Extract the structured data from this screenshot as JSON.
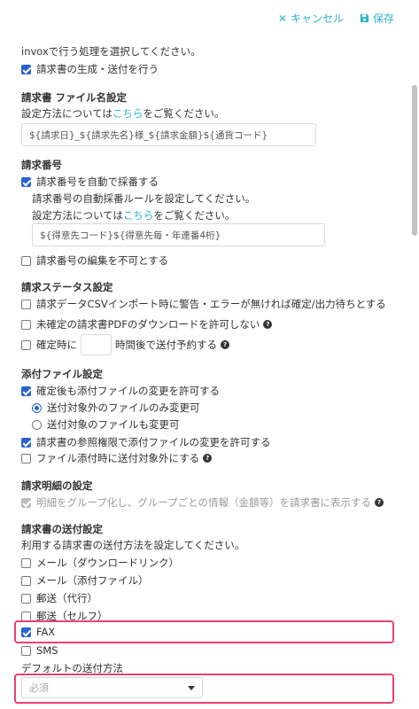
{
  "topbar": {
    "cancel_label": "キャンセル",
    "save_label": "保存"
  },
  "processing": {
    "intro": "invoxで行う処理を選択してください。",
    "generate_send": "請求書の生成・送付を行う"
  },
  "filename": {
    "heading": "請求書 ファイル名設定",
    "method_prefix": "設定方法については",
    "link": "こちら",
    "method_suffix": "をご覧ください。",
    "value": "${請求日}_${請求先名}様_${請求金額}${通貨コード}"
  },
  "invoice_number": {
    "heading": "請求番号",
    "auto_number": "請求番号を自動で採番する",
    "rule_text": "請求番号の自動採番ルールを設定してください。",
    "method_prefix": "設定方法については",
    "link": "こちら",
    "method_suffix": "をご覧ください。",
    "value": "${得意先コード}${得意先毎・年連番4桁}",
    "disable_edit": "請求番号の編集を不可とする"
  },
  "status": {
    "heading": "請求ステータス設定",
    "csv_option": "請求データCSVインポート時に警告・エラーが無ければ確定/出力待ちとする",
    "pdf_option": "未確定の請求書PDFのダウンロードを許可しない",
    "schedule_prefix": "確定時に",
    "schedule_suffix": "時間後で送付予約する"
  },
  "attachments": {
    "heading": "添付ファイル設定",
    "allow_change": "確定後も添付ファイルの変更を許可する",
    "radio_exclude_only": "送付対象外のファイルのみ変更可",
    "radio_include": "送付対象のファイルも変更可",
    "perm_option": "請求書の参照権限で添付ファイルの変更を許可する",
    "exclude_on_attach": "ファイル添付時に送付対象外にする"
  },
  "details": {
    "heading": "請求明細の設定",
    "group_option": "明細をグループ化し、グループごとの情報（金額等）を請求書に表示する"
  },
  "sending": {
    "heading": "請求書の送付設定",
    "intro": "利用する請求書の送付方法を設定してください。",
    "methods": [
      "メール（ダウンロードリンク）",
      "メール（添付ファイル）",
      "郵送（代行）",
      "郵送（セルフ）",
      "FAX",
      "SMS"
    ],
    "default_label": "デフォルトの送付方法",
    "select_placeholder": "必須"
  },
  "colors": {
    "accent": "#2ab3c8",
    "checkbox": "#2962d3",
    "highlight": "#e8416e"
  }
}
